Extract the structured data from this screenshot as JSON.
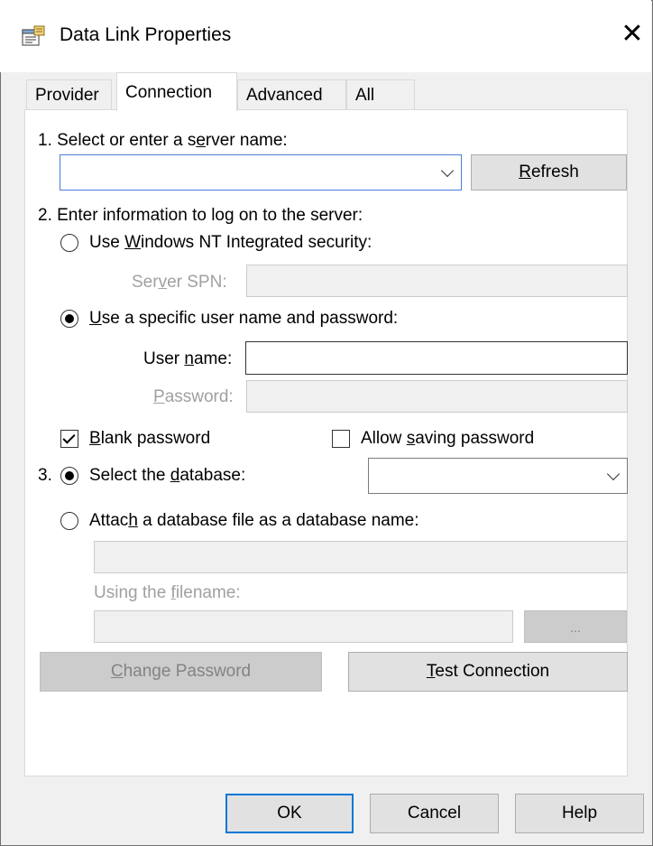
{
  "window": {
    "title": "Data Link Properties",
    "close_glyph": "✕",
    "icon": "data-link-icon"
  },
  "tabs": [
    "Provider",
    "Connection",
    "Advanced",
    "All"
  ],
  "active_tab": "Connection",
  "step1": {
    "label_pre": "1. Select or enter a s",
    "label_u": "e",
    "label_post": "rver name:",
    "server_value": "",
    "refresh_u": "R",
    "refresh_post": "efresh"
  },
  "step2": {
    "label": "2. Enter information to log on to the server:",
    "nt_pre": "Use ",
    "nt_u": "W",
    "nt_post": "indows NT Integrated security:",
    "spn_pre": "Ser",
    "spn_u": "v",
    "spn_post": "er SPN:",
    "specific_u": "U",
    "specific_post": "se a specific user name and password:",
    "username_pre": "User ",
    "username_u": "n",
    "username_post": "ame:",
    "username_value": "",
    "password_u": "P",
    "password_post": "assword:",
    "blank_u": "B",
    "blank_post": "lank password",
    "blank_checked": true,
    "allow_pre": "Allow ",
    "allow_u": "s",
    "allow_post": "aving password",
    "allow_checked": false
  },
  "step3": {
    "num": "3.",
    "select_pre": "Select the ",
    "select_u": "d",
    "select_post": "atabase:",
    "database_value": "",
    "attach_pre": "Attac",
    "attach_u": "h",
    "attach_post": " a database file as a database name:",
    "filename_pre": "Using the ",
    "filename_u": "f",
    "filename_post": "ilename:",
    "browse_label": "..."
  },
  "actions": {
    "change_u": "C",
    "change_post": "hange Password",
    "test_u": "T",
    "test_post": "est Connection"
  },
  "footer": {
    "ok": "OK",
    "cancel": "Cancel",
    "help": "Help"
  }
}
